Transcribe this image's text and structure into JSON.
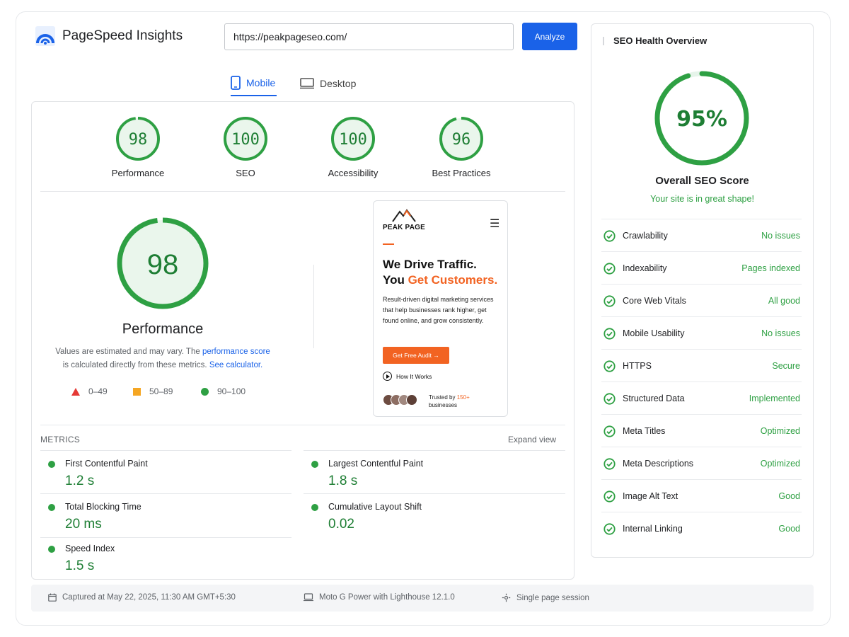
{
  "app": {
    "title": "PageSpeed Insights"
  },
  "search": {
    "url_value": "https://peakpageseo.com/",
    "analyze_label": "Analyze"
  },
  "tabs": [
    {
      "label": "Mobile",
      "active": true
    },
    {
      "label": "Desktop",
      "active": false
    }
  ],
  "scores": [
    {
      "value": "98",
      "label": "Performance"
    },
    {
      "value": "100",
      "label": "SEO"
    },
    {
      "value": "100",
      "label": "Accessibility"
    },
    {
      "value": "96",
      "label": "Best Practices"
    }
  ],
  "performance": {
    "value": "98",
    "label": "Performance",
    "note_prefix": "Values are estimated and may vary. The ",
    "note_link1": "performance score",
    "note_mid": "is calculated directly from these metrics. ",
    "note_link2": "See calculator.",
    "legend": [
      {
        "range": "0–49"
      },
      {
        "range": "50–89"
      },
      {
        "range": "90–100"
      }
    ]
  },
  "preview": {
    "brand": "PEAK PAGE",
    "hero_line1": "We Drive Traffic.",
    "hero_line2_prefix": "You ",
    "hero_line2_highlight": "Get Customers.",
    "copy": "Result-driven digital marketing services that help businesses rank higher, get found online, and grow consistently.",
    "cta_label": "Get Free Audit →",
    "secondary_label": "How It Works",
    "trusted_prefix": "Trusted by ",
    "trusted_highlight": "150+",
    "trusted_suffix": "businesses"
  },
  "metrics": {
    "title": "METRICS",
    "expand_label": "Expand view",
    "items": [
      {
        "label": "First Contentful Paint",
        "value": "1.2 s"
      },
      {
        "label": "Largest Contentful Paint",
        "value": "1.8 s"
      },
      {
        "label": "Total Blocking Time",
        "value": "20 ms"
      },
      {
        "label": "Cumulative Layout Shift",
        "value": "0.02"
      },
      {
        "label": "Speed Index",
        "value": "1.5 s"
      }
    ]
  },
  "seo_health": {
    "title": "SEO Health Overview",
    "score": "95%",
    "score_fraction": 0.95,
    "score_label": "Overall SEO Score",
    "score_message": "Your site is in great shape!",
    "checks": [
      {
        "label": "Crawlability",
        "status": "No issues"
      },
      {
        "label": "Indexability",
        "status": "Pages indexed"
      },
      {
        "label": "Core Web Vitals",
        "status": "All good"
      },
      {
        "label": "Mobile Usability",
        "status": "No issues"
      },
      {
        "label": "HTTPS",
        "status": "Secure"
      },
      {
        "label": "Structured Data",
        "status": "Implemented"
      },
      {
        "label": "Meta Titles",
        "status": "Optimized"
      },
      {
        "label": "Meta Descriptions",
        "status": "Optimized"
      },
      {
        "label": "Image Alt Text",
        "status": "Good"
      },
      {
        "label": "Internal Linking",
        "status": "Good"
      }
    ]
  },
  "footer": {
    "captured": "Captured at May 22, 2025, 11:30 AM GMT+5:30",
    "device": "Moto G Power with Lighthouse 12.1.0",
    "session": "Single page session"
  },
  "colors": {
    "accent": "#1a62e8",
    "good": "#2ea043",
    "good_text": "#1e7e34",
    "brand_orange": "#f26322"
  }
}
